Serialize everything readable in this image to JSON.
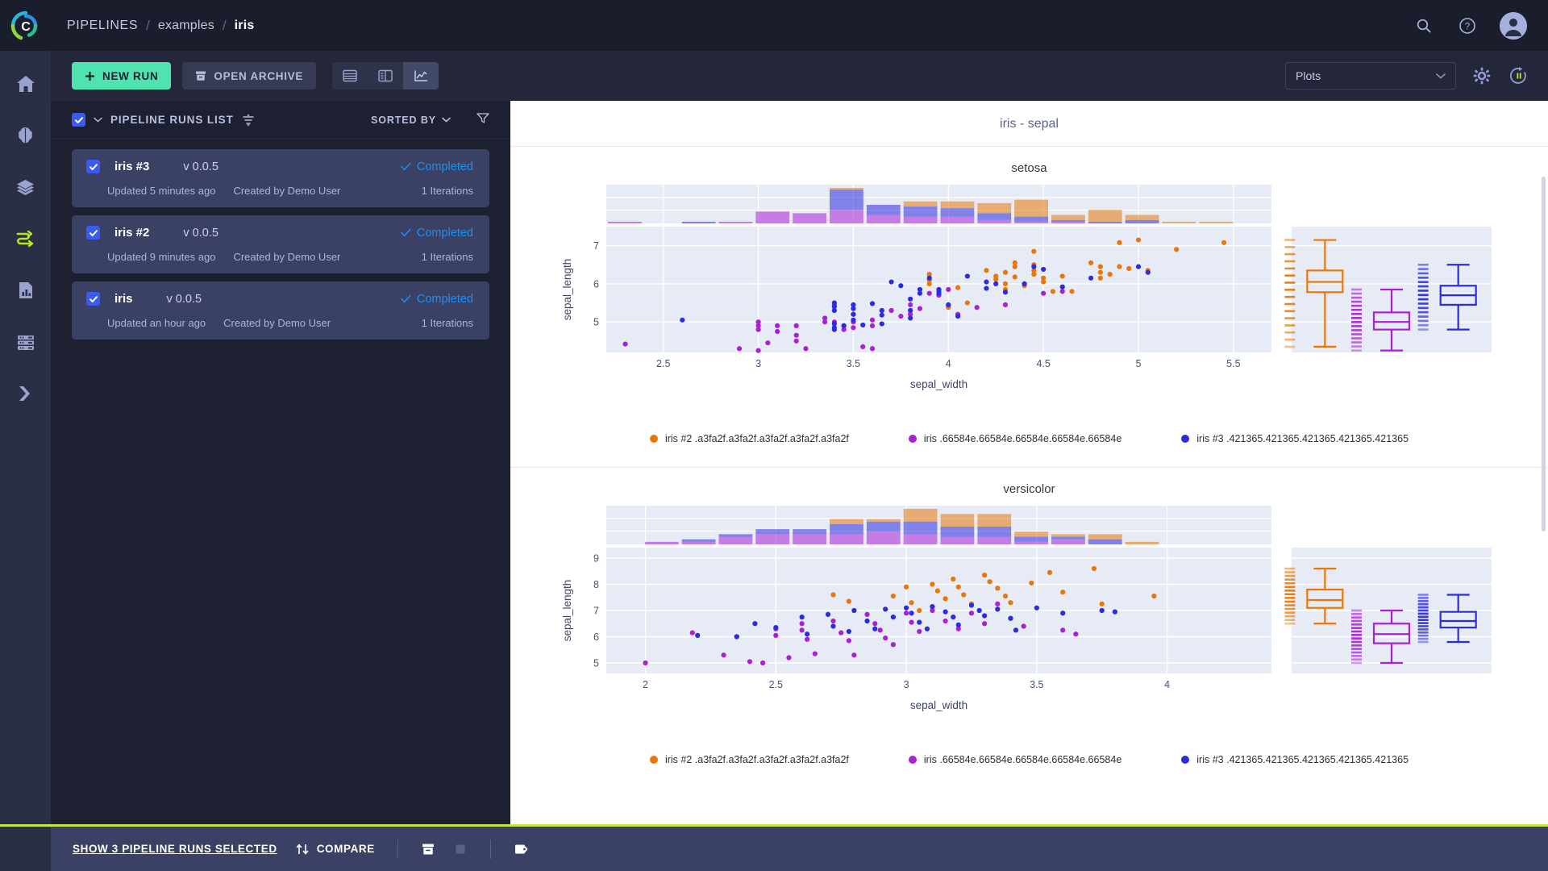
{
  "header": {
    "breadcrumb": [
      {
        "label": "PIPELINES",
        "current": false
      },
      {
        "label": "examples",
        "current": false
      },
      {
        "label": "iris",
        "current": true
      }
    ],
    "separator": "/",
    "icons": [
      "search-icon",
      "help-icon",
      "user-avatar"
    ]
  },
  "rail": {
    "items": [
      {
        "name": "home-icon",
        "active": false
      },
      {
        "name": "models-brain-icon",
        "active": false
      },
      {
        "name": "datasets-layers-icon",
        "active": false
      },
      {
        "name": "pipelines-icon",
        "active": true
      },
      {
        "name": "reports-icon",
        "active": false
      },
      {
        "name": "server-icon",
        "active": false
      },
      {
        "name": "deployments-icon",
        "active": false
      }
    ],
    "active_color": "#b4e819"
  },
  "toolbar": {
    "new_run": "NEW RUN",
    "open_archive": "OPEN ARCHIVE",
    "view_modes": [
      "table-view-icon",
      "split-view-icon",
      "chart-view-icon"
    ],
    "active_view": "chart-view-icon",
    "plots_select": "Plots",
    "settings_icon": "gear-icon",
    "refresh_icon": "auto-refresh-pause-icon"
  },
  "runs_panel": {
    "title": "PIPELINE RUNS LIST",
    "sort_label": "SORTED BY",
    "select_all_checked": true,
    "runs": [
      {
        "name": "iris #3",
        "version": "v 0.0.5",
        "status": "Completed",
        "updated": "Updated 5 minutes ago",
        "created_by": "Created by Demo User",
        "iterations": "1 Iterations",
        "checked": true
      },
      {
        "name": "iris #2",
        "version": "v 0.0.5",
        "status": "Completed",
        "updated": "Updated 9 minutes ago",
        "created_by": "Created by Demo User",
        "iterations": "1 Iterations",
        "checked": true
      },
      {
        "name": "iris",
        "version": "v 0.0.5",
        "status": "Completed",
        "updated": "Updated an hour ago",
        "created_by": "Created by Demo User",
        "iterations": "1 Iterations",
        "checked": true
      }
    ]
  },
  "bottom_bar": {
    "selection_label": "SHOW 3 PIPELINE RUNS SELECTED",
    "compare_label": "COMPARE",
    "icons": [
      "archive-icon",
      "stop-icon",
      "tag-icon"
    ]
  },
  "plots": {
    "main_title": "iris - sepal",
    "colors": {
      "series1": "#e8770a",
      "series2": "#a921d4",
      "series3": "#2b2be0",
      "plot_bg": "#e7ebf5",
      "grid": "#ffffff"
    }
  },
  "chart_data": [
    {
      "type": "scatter",
      "title": "setosa",
      "subtitle": "iris - sepal",
      "xlabel": "sepal_width",
      "ylabel": "sepal_length",
      "xticks": [
        2.5,
        3,
        3.5,
        4,
        4.5,
        5,
        5.5
      ],
      "yticks": [
        5,
        6,
        7
      ],
      "xlim": [
        2.2,
        5.7
      ],
      "ylim": [
        4.2,
        7.5
      ],
      "grid": true,
      "legend_position": "bottom",
      "marginal_top": "histogram",
      "marginal_right": "boxplot",
      "series": [
        {
          "name": "iris #2 .a3fa2f.a3fa2f.a3fa2f.a3fa2f.a3fa2f",
          "color": "#e8770a",
          "points": [
            [
              3.4,
              5.45
            ],
            [
              3.9,
              6.25
            ],
            [
              3.9,
              6.1
            ],
            [
              3.9,
              6.0
            ],
            [
              4.05,
              5.9
            ],
            [
              4.1,
              5.5
            ],
            [
              4.0,
              5.42
            ],
            [
              4.0,
              5.38
            ],
            [
              4.2,
              6.35
            ],
            [
              4.25,
              6.2
            ],
            [
              4.25,
              6.12
            ],
            [
              4.3,
              6.0
            ],
            [
              4.3,
              5.85
            ],
            [
              4.35,
              6.55
            ],
            [
              4.35,
              6.45
            ],
            [
              4.3,
              6.3
            ],
            [
              4.35,
              6.18
            ],
            [
              4.4,
              5.95
            ],
            [
              4.45,
              6.85
            ],
            [
              4.45,
              6.5
            ],
            [
              4.45,
              6.35
            ],
            [
              4.45,
              6.25
            ],
            [
              4.5,
              6.15
            ],
            [
              4.5,
              6.05
            ],
            [
              4.55,
              5.8
            ],
            [
              4.6,
              6.2
            ],
            [
              4.65,
              5.8
            ],
            [
              4.75,
              6.55
            ],
            [
              4.8,
              6.45
            ],
            [
              4.8,
              6.3
            ],
            [
              4.8,
              6.15
            ],
            [
              4.85,
              6.25
            ],
            [
              4.9,
              7.08
            ],
            [
              4.9,
              6.45
            ],
            [
              4.95,
              6.4
            ],
            [
              5.0,
              7.15
            ],
            [
              5.05,
              6.35
            ],
            [
              5.2,
              6.9
            ],
            [
              5.45,
              7.08
            ]
          ],
          "box": {
            "min": 4.35,
            "q1": 5.78,
            "median": 6.05,
            "q3": 6.35,
            "max": 7.15
          }
        },
        {
          "name": "iris .66584e.66584e.66584e.66584e.66584e",
          "color": "#a921d4",
          "points": [
            [
              2.3,
              4.42
            ],
            [
              2.9,
              4.3
            ],
            [
              3.0,
              5.0
            ],
            [
              3.0,
              4.9
            ],
            [
              3.0,
              4.8
            ],
            [
              3.05,
              4.45
            ],
            [
              3.0,
              4.25
            ],
            [
              3.1,
              4.9
            ],
            [
              3.1,
              4.75
            ],
            [
              3.2,
              4.9
            ],
            [
              3.2,
              4.65
            ],
            [
              3.2,
              4.5
            ],
            [
              3.25,
              4.3
            ],
            [
              3.35,
              5.1
            ],
            [
              3.35,
              5.0
            ],
            [
              3.4,
              5.42
            ],
            [
              3.4,
              5.0
            ],
            [
              3.45,
              4.9
            ],
            [
              3.45,
              4.8
            ],
            [
              3.5,
              5.2
            ],
            [
              3.5,
              5.0
            ],
            [
              3.5,
              4.85
            ],
            [
              3.55,
              4.35
            ],
            [
              3.6,
              5.05
            ],
            [
              3.6,
              4.9
            ],
            [
              3.6,
              4.3
            ],
            [
              3.7,
              5.3
            ],
            [
              3.75,
              5.15
            ],
            [
              3.8,
              5.45
            ],
            [
              3.8,
              5.2
            ],
            [
              3.85,
              5.35
            ],
            [
              3.9,
              5.75
            ],
            [
              3.95,
              5.8
            ],
            [
              3.95,
              5.7
            ],
            [
              4.0,
              5.85
            ],
            [
              4.05,
              5.2
            ],
            [
              4.15,
              5.38
            ],
            [
              4.3,
              5.45
            ],
            [
              4.5,
              5.75
            ],
            [
              4.6,
              5.8
            ]
          ],
          "box": {
            "min": 4.25,
            "q1": 4.8,
            "median": 5.0,
            "q3": 5.25,
            "max": 5.85
          }
        },
        {
          "name": "iris #3 .421365.421365.421365.421365.421365",
          "color": "#2b2be0",
          "points": [
            [
              2.6,
              5.05
            ],
            [
              3.4,
              5.5
            ],
            [
              3.4,
              5.4
            ],
            [
              3.4,
              5.3
            ],
            [
              3.4,
              4.95
            ],
            [
              3.4,
              4.85
            ],
            [
              3.4,
              4.8
            ],
            [
              3.45,
              4.9
            ],
            [
              3.5,
              5.45
            ],
            [
              3.5,
              5.35
            ],
            [
              3.5,
              5.2
            ],
            [
              3.5,
              5.05
            ],
            [
              3.55,
              4.92
            ],
            [
              3.6,
              5.48
            ],
            [
              3.65,
              5.3
            ],
            [
              3.65,
              5.18
            ],
            [
              3.65,
              4.95
            ],
            [
              3.7,
              6.05
            ],
            [
              3.75,
              5.95
            ],
            [
              3.8,
              5.6
            ],
            [
              3.8,
              5.3
            ],
            [
              3.8,
              5.1
            ],
            [
              3.85,
              5.85
            ],
            [
              3.85,
              5.75
            ],
            [
              3.9,
              6.15
            ],
            [
              3.95,
              5.85
            ],
            [
              3.95,
              5.75
            ],
            [
              4.0,
              5.45
            ],
            [
              4.05,
              5.15
            ],
            [
              4.1,
              6.2
            ],
            [
              4.2,
              6.05
            ],
            [
              4.2,
              5.88
            ],
            [
              4.25,
              6.0
            ],
            [
              4.3,
              5.78
            ],
            [
              4.4,
              6.0
            ],
            [
              4.45,
              6.45
            ],
            [
              4.5,
              6.38
            ],
            [
              4.6,
              5.92
            ],
            [
              4.75,
              6.15
            ],
            [
              5.0,
              6.45
            ],
            [
              5.05,
              6.3
            ]
          ],
          "box": {
            "min": 4.8,
            "q1": 5.45,
            "median": 5.7,
            "q3": 5.95,
            "max": 6.5
          }
        }
      ]
    },
    {
      "type": "scatter",
      "title": "versicolor",
      "xlabel": "sepal_width",
      "ylabel": "sepal_length",
      "xticks": [
        2,
        2.5,
        3,
        3.5,
        4
      ],
      "yticks": [
        5,
        6,
        7,
        8,
        9
      ],
      "xlim": [
        1.85,
        4.4
      ],
      "ylim": [
        4.6,
        9.4
      ],
      "grid": true,
      "legend_position": "bottom",
      "marginal_top": "histogram",
      "marginal_right": "boxplot",
      "series": [
        {
          "name": "iris #2 .a3fa2f.a3fa2f.a3fa2f.a3fa2f.a3fa2f",
          "color": "#e8770a",
          "points": [
            [
              2.72,
              7.6
            ],
            [
              2.78,
              7.35
            ],
            [
              2.95,
              7.55
            ],
            [
              3.0,
              7.9
            ],
            [
              3.02,
              7.3
            ],
            [
              3.05,
              7.0
            ],
            [
              3.1,
              8.0
            ],
            [
              3.12,
              7.75
            ],
            [
              3.15,
              7.45
            ],
            [
              3.18,
              8.2
            ],
            [
              3.2,
              7.9
            ],
            [
              3.22,
              7.6
            ],
            [
              3.25,
              7.25
            ],
            [
              3.3,
              8.35
            ],
            [
              3.32,
              8.1
            ],
            [
              3.35,
              7.85
            ],
            [
              3.38,
              7.55
            ],
            [
              3.4,
              7.3
            ],
            [
              3.48,
              8.05
            ],
            [
              3.55,
              8.45
            ],
            [
              3.6,
              7.7
            ],
            [
              3.72,
              8.6
            ],
            [
              3.75,
              7.25
            ],
            [
              3.95,
              7.55
            ]
          ],
          "box": {
            "min": 6.5,
            "q1": 7.1,
            "median": 7.4,
            "q3": 7.8,
            "max": 8.6
          }
        },
        {
          "name": "iris .66584e.66584e.66584e.66584e.66584e",
          "color": "#a921d4",
          "points": [
            [
              2.0,
              5.0
            ],
            [
              2.18,
              6.15
            ],
            [
              2.3,
              5.3
            ],
            [
              2.35,
              6.0
            ],
            [
              2.4,
              5.05
            ],
            [
              2.45,
              5.0
            ],
            [
              2.5,
              6.3
            ],
            [
              2.5,
              6.05
            ],
            [
              2.55,
              5.2
            ],
            [
              2.6,
              6.5
            ],
            [
              2.6,
              6.25
            ],
            [
              2.62,
              5.9
            ],
            [
              2.65,
              5.35
            ],
            [
              2.72,
              6.6
            ],
            [
              2.75,
              6.15
            ],
            [
              2.78,
              5.85
            ],
            [
              2.8,
              5.3
            ],
            [
              2.85,
              6.85
            ],
            [
              2.88,
              6.5
            ],
            [
              2.9,
              6.25
            ],
            [
              2.92,
              5.95
            ],
            [
              2.95,
              5.7
            ],
            [
              3.0,
              6.9
            ],
            [
              3.02,
              6.55
            ],
            [
              3.05,
              6.2
            ],
            [
              3.1,
              7.0
            ],
            [
              3.15,
              6.6
            ],
            [
              3.2,
              6.3
            ],
            [
              3.25,
              6.9
            ],
            [
              3.3,
              6.5
            ],
            [
              3.35,
              7.25
            ],
            [
              3.4,
              6.7
            ],
            [
              3.45,
              6.4
            ],
            [
              3.6,
              6.25
            ],
            [
              3.65,
              6.1
            ]
          ],
          "box": {
            "min": 5.0,
            "q1": 5.75,
            "median": 6.1,
            "q3": 6.5,
            "max": 7.0
          }
        },
        {
          "name": "iris #3 .421365.421365.421365.421365.421365",
          "color": "#2b2be0",
          "points": [
            [
              2.2,
              6.05
            ],
            [
              2.35,
              6.0
            ],
            [
              2.42,
              6.5
            ],
            [
              2.5,
              6.35
            ],
            [
              2.6,
              6.75
            ],
            [
              2.62,
              6.1
            ],
            [
              2.7,
              6.85
            ],
            [
              2.72,
              6.4
            ],
            [
              2.78,
              6.2
            ],
            [
              2.8,
              7.0
            ],
            [
              2.85,
              6.6
            ],
            [
              2.88,
              6.3
            ],
            [
              2.92,
              7.05
            ],
            [
              2.95,
              6.75
            ],
            [
              3.0,
              7.1
            ],
            [
              3.02,
              6.9
            ],
            [
              3.05,
              6.55
            ],
            [
              3.08,
              6.3
            ],
            [
              3.1,
              7.15
            ],
            [
              3.15,
              6.95
            ],
            [
              3.18,
              6.75
            ],
            [
              3.2,
              6.45
            ],
            [
              3.25,
              7.2
            ],
            [
              3.28,
              7.0
            ],
            [
              3.3,
              6.8
            ],
            [
              3.35,
              7.05
            ],
            [
              3.4,
              6.7
            ],
            [
              3.42,
              6.25
            ],
            [
              3.5,
              7.1
            ],
            [
              3.6,
              6.9
            ],
            [
              3.75,
              7.0
            ],
            [
              3.8,
              6.95
            ]
          ],
          "box": {
            "min": 5.8,
            "q1": 6.35,
            "median": 6.6,
            "q3": 6.95,
            "max": 7.6
          }
        }
      ]
    }
  ]
}
